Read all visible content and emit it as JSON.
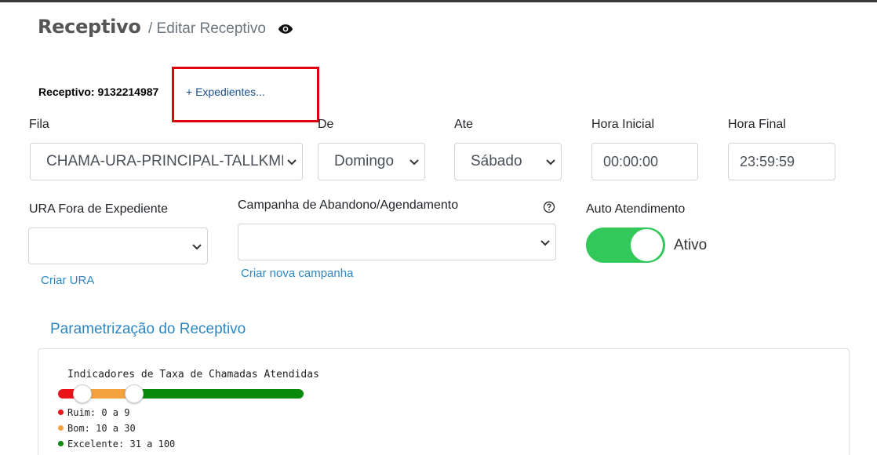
{
  "header": {
    "title": "Receptivo",
    "breadcrumb": "/ Editar Receptivo"
  },
  "receptivo": {
    "label": "Receptivo: 9132214987",
    "expedientes_link": "+ Expedientes..."
  },
  "form": {
    "fila": {
      "label": "Fila",
      "value": "CHAMA-URA-PRINCIPAL-TALLKMED"
    },
    "de": {
      "label": "De",
      "value": "Domingo"
    },
    "ate": {
      "label": "Ate",
      "value": "Sábado"
    },
    "hora_inicial": {
      "label": "Hora Inicial",
      "value": "00:00:00"
    },
    "hora_final": {
      "label": "Hora Final",
      "value": "23:59:59"
    },
    "ura_fora": {
      "label": "URA Fora de Expediente",
      "value": "",
      "link": "Criar URA"
    },
    "campanha": {
      "label": "Campanha de Abandono/Agendamento",
      "value": "",
      "link": "Criar nova campanha"
    },
    "auto_atendimento": {
      "label": "Auto Atendimento",
      "state": "Ativo",
      "on": true
    }
  },
  "parametrizacao": {
    "title": "Parametrização do Receptivo",
    "indicator_title": "Indicadores de Taxa de Chamadas Atendidas",
    "slider": {
      "min": 0,
      "max": 100,
      "handles": [
        10,
        31
      ]
    },
    "legend": [
      {
        "label": "Ruim: 0 a 9",
        "color": "#e8141a"
      },
      {
        "label": "Bom: 10 a 30",
        "color": "#f4a140"
      },
      {
        "label": "Excelente: 31 a 100",
        "color": "#0a8a0a"
      }
    ]
  },
  "colors": {
    "accent_link": "#2e86c1",
    "toggle_on": "#33c95a",
    "highlight": "#e0000e"
  }
}
